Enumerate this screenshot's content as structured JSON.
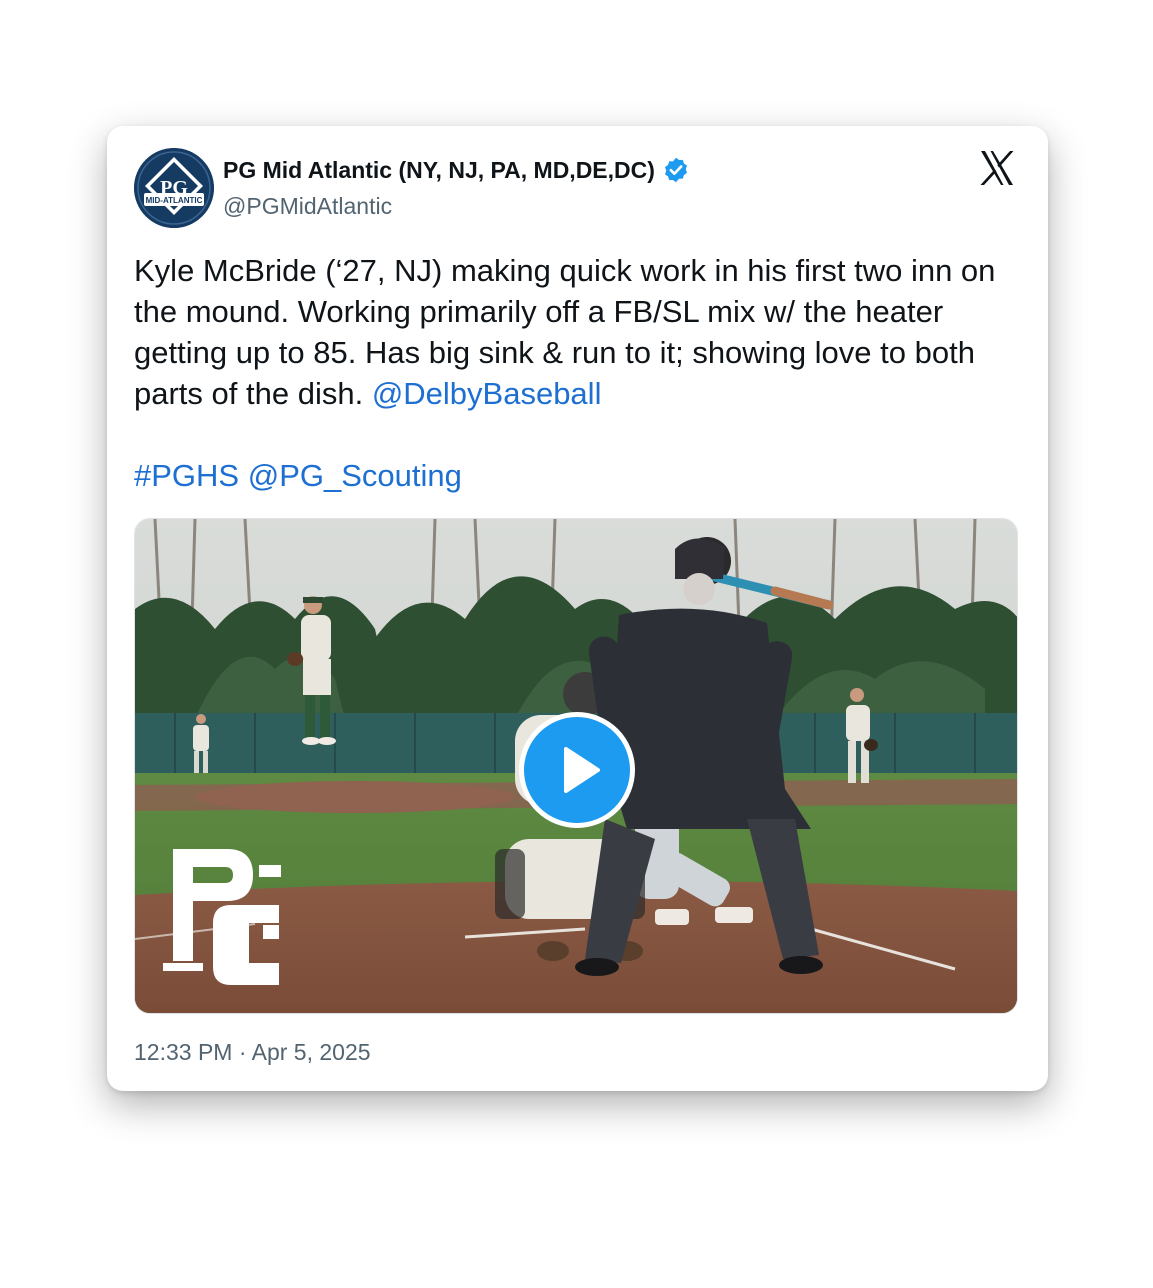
{
  "tweet": {
    "display_name": "PG Mid Atlantic (NY, NJ, PA, MD,DE,DC)",
    "handle": "@PGMidAtlantic",
    "avatar_text": "MID-ATLANTIC",
    "body_text": "Kyle McBride (‘27, NJ) making quick work in his first two inn on the mound. Working primarily off a FB/SL mix w/ the heater getting up to 85. Has big sink & run to it; showing love to both parts of the dish. ",
    "mention_1": "@DelbyBaseball",
    "hashtag": "#PGHS",
    "mention_2": "@PG_Scouting",
    "timestamp": "12:33 PM · Apr 5, 2025"
  },
  "media": {
    "type": "video",
    "watermark_logo": "PG"
  },
  "icons": {
    "verified": "verified-badge-icon",
    "platform": "x-logo-icon",
    "play": "play-icon"
  },
  "colors": {
    "link": "#1d6fd1",
    "verified": "#1d9bf0",
    "play_button": "#1d9bf0",
    "avatar_bg": "#153b63"
  }
}
